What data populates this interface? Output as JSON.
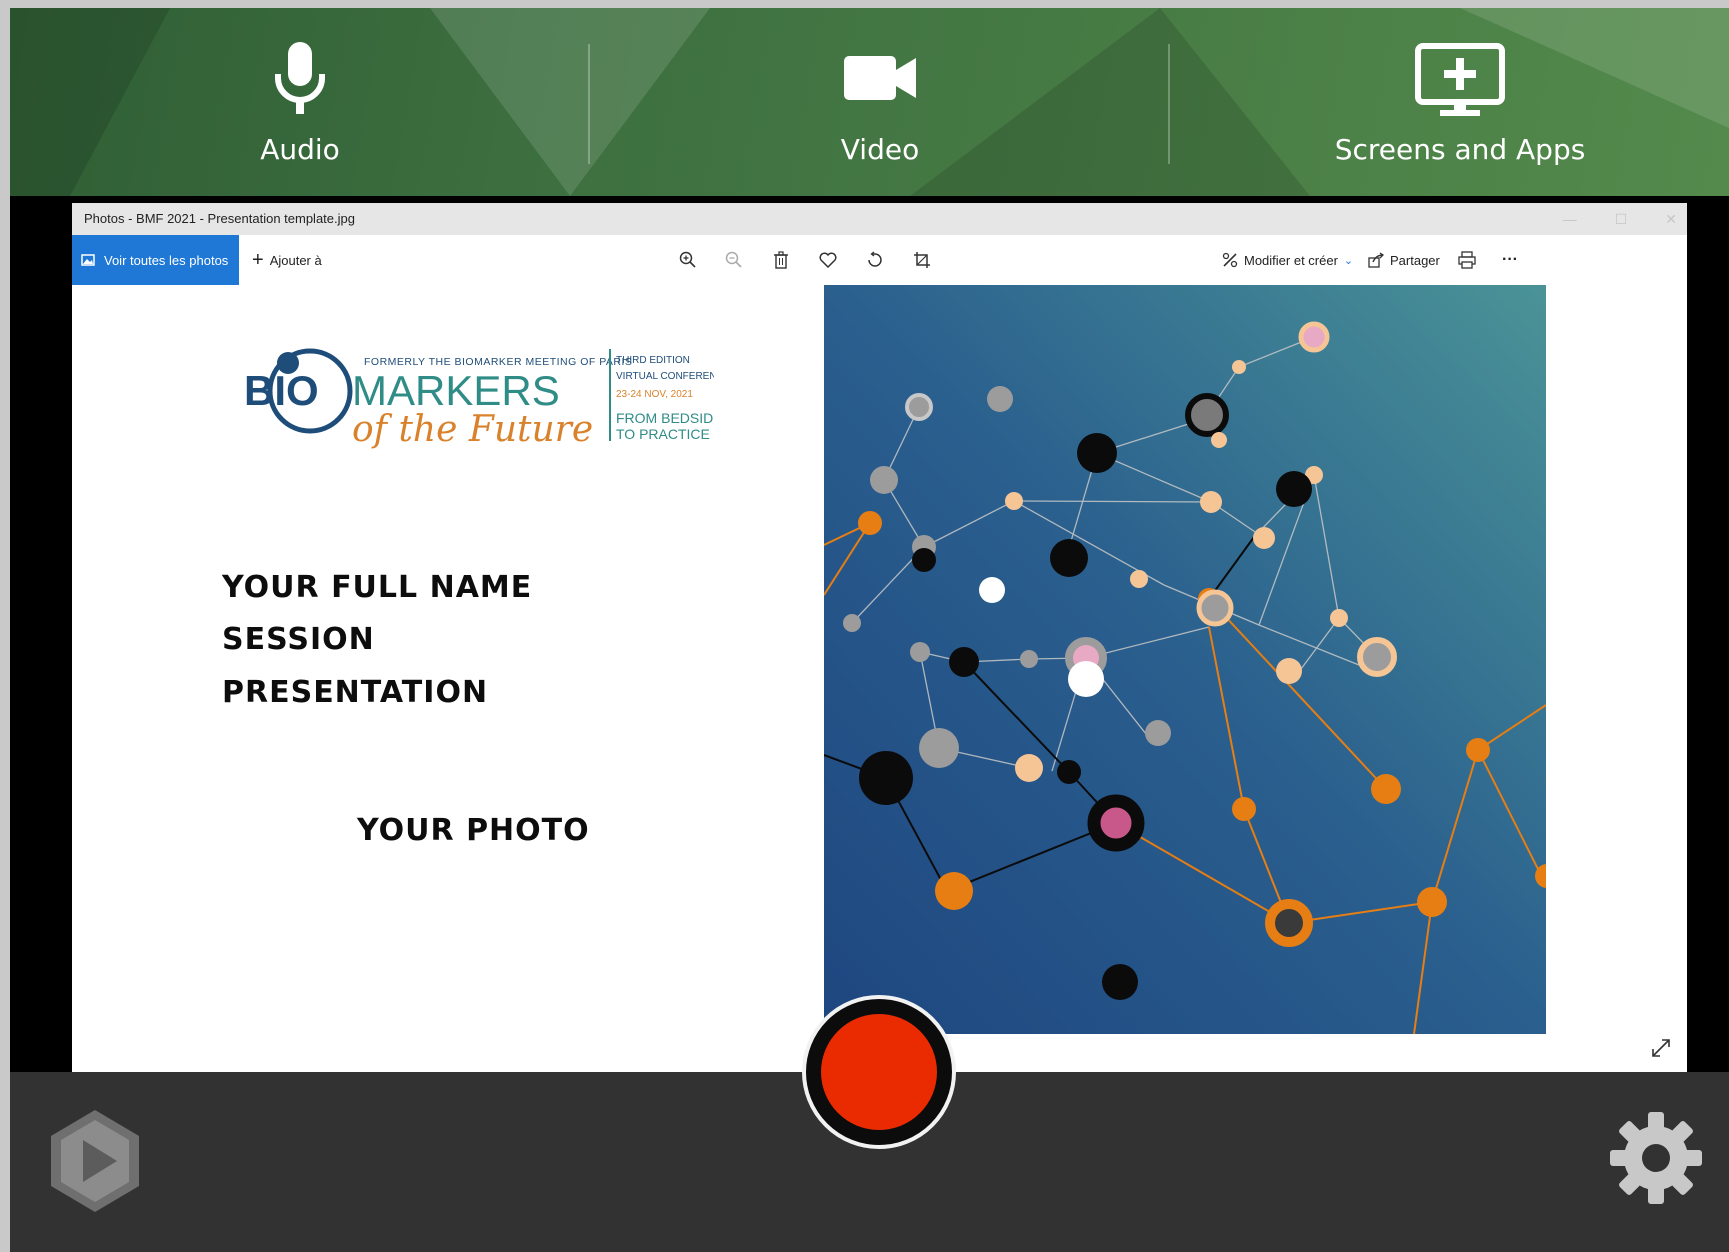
{
  "sources": {
    "audio_label": "Audio",
    "video_label": "Video",
    "screens_label": "Screens and Apps"
  },
  "photos_window": {
    "title": "Photos - BMF 2021 - Presentation template.jpg",
    "toolbar": {
      "see_all_label": "Voir toutes les photos",
      "add_to_label": "Ajouter à",
      "edit_create_label": "Modifier et créer",
      "share_label": "Partager",
      "more_label": "···",
      "icons": [
        "zoom-in-icon",
        "zoom-out-icon",
        "delete-icon",
        "favorite-icon",
        "rotate-icon",
        "crop-icon",
        "print-icon"
      ]
    }
  },
  "slide": {
    "logo": {
      "tagline": "FORMERLY THE BIOMARKER MEETING OF PARIS",
      "word_bio": "BIO",
      "word_markers": "MARKERS",
      "script": "of the Future",
      "edition": "THIRD EDITION",
      "conference": "VIRTUAL CONFERENCE",
      "dates": "23-24 NOV, 2021",
      "motto_1": "FROM BEDSIDE",
      "motto_2": "TO PRACTICE"
    },
    "name_line": "YOUR FULL NAME",
    "session_line": "SESSION",
    "presentation_line": "PRESENTATION",
    "photo_line": "YOUR PHOTO"
  },
  "colors": {
    "topbar_green": "#467a44",
    "record_red": "#ea2a00",
    "bottombar": "#323232",
    "windows_blue": "#1f78d6",
    "network_bg_top": "#3f8a98",
    "network_bg_bottom": "#1f477f",
    "node_orange": "#e67e13",
    "node_peach": "#f6c596"
  }
}
